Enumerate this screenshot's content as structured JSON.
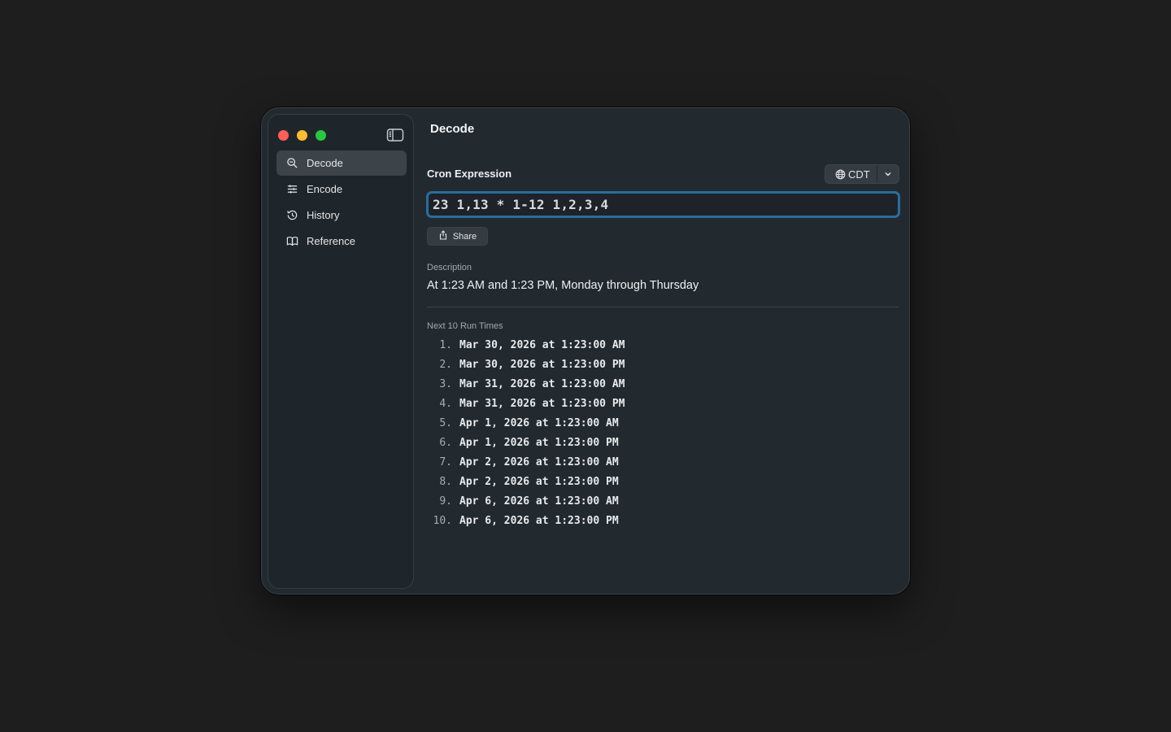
{
  "sidebar": {
    "items": [
      {
        "label": "Decode",
        "icon": "search-icon",
        "active": true
      },
      {
        "label": "Encode",
        "icon": "sliders-icon",
        "active": false
      },
      {
        "label": "History",
        "icon": "history-icon",
        "active": false
      },
      {
        "label": "Reference",
        "icon": "book-icon",
        "active": false
      }
    ]
  },
  "main": {
    "title": "Decode",
    "cron_label": "Cron Expression",
    "timezone": "CDT",
    "cron_value": "23 1,13 * 1-12 1,2,3,4",
    "share_label": "Share",
    "description_label": "Description",
    "description": "At 1:23 AM and 1:23 PM, Monday through Thursday",
    "runs_label": "Next 10 Run Times",
    "runs": [
      {
        "num": "1.",
        "value": "Mar 30, 2026 at 1:23:00 AM"
      },
      {
        "num": "2.",
        "value": "Mar 30, 2026 at 1:23:00 PM"
      },
      {
        "num": "3.",
        "value": "Mar 31, 2026 at 1:23:00 AM"
      },
      {
        "num": "4.",
        "value": "Mar 31, 2026 at 1:23:00 PM"
      },
      {
        "num": "5.",
        "value": "Apr 1, 2026 at 1:23:00 AM"
      },
      {
        "num": "6.",
        "value": "Apr 1, 2026 at 1:23:00 PM"
      },
      {
        "num": "7.",
        "value": "Apr 2, 2026 at 1:23:00 AM"
      },
      {
        "num": "8.",
        "value": "Apr 2, 2026 at 1:23:00 PM"
      },
      {
        "num": "9.",
        "value": "Apr 6, 2026 at 1:23:00 AM"
      },
      {
        "num": "10.",
        "value": "Apr 6, 2026 at 1:23:00 PM"
      }
    ]
  },
  "colors": {
    "accent_focus": "#2a6c9e",
    "close": "#ff5f57",
    "minimize": "#febc2e",
    "zoom": "#28c840"
  }
}
